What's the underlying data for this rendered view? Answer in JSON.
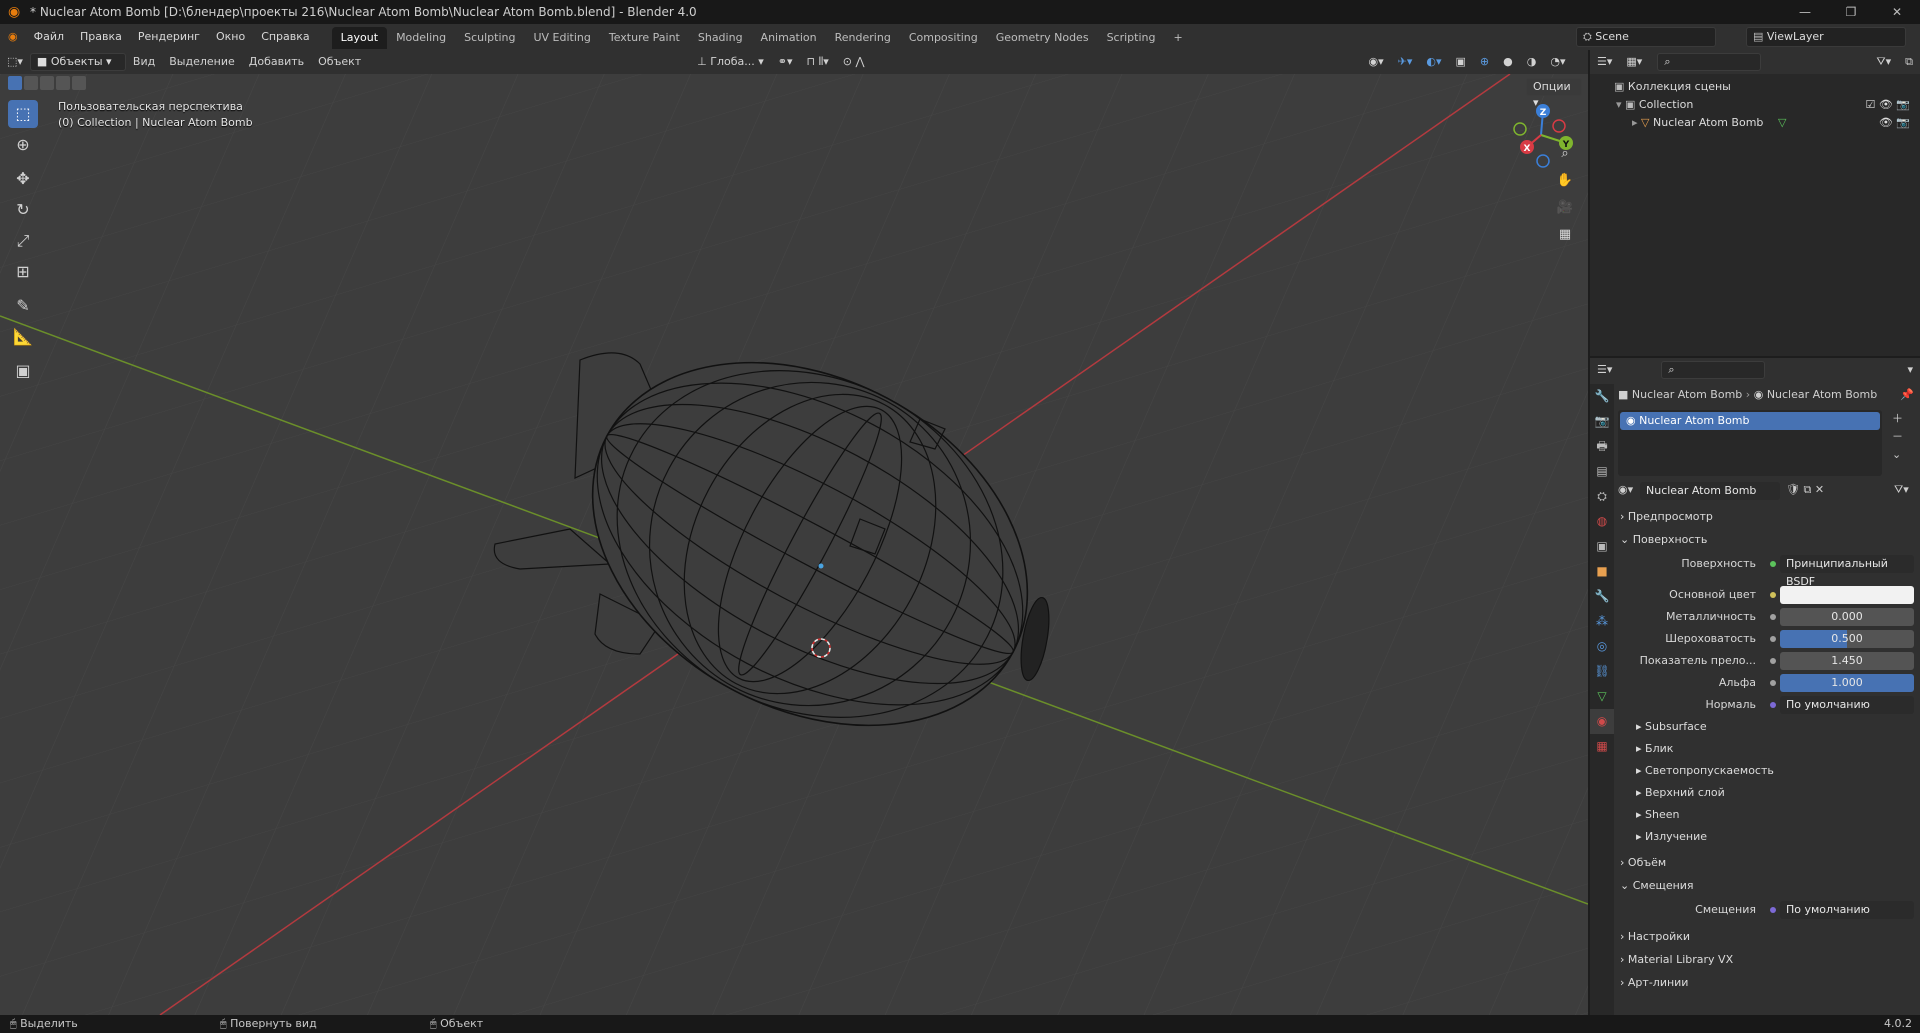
{
  "window": {
    "title": "* Nuclear Atom Bomb [D:\\блендер\\проекты 216\\Nuclear Atom Bomb\\Nuclear Atom Bomb.blend] - Blender 4.0"
  },
  "menu": [
    "Файл",
    "Правка",
    "Рендеринг",
    "Окно",
    "Справка"
  ],
  "workspaces": [
    "Layout",
    "Modeling",
    "Sculpting",
    "UV Editing",
    "Texture Paint",
    "Shading",
    "Animation",
    "Rendering",
    "Compositing",
    "Geometry Nodes",
    "Scripting",
    "+"
  ],
  "scene": {
    "name": "Scene",
    "view_layer": "ViewLayer"
  },
  "viewport_header": {
    "mode": "Объекты",
    "menus": [
      "Вид",
      "Выделение",
      "Добавить",
      "Объект"
    ],
    "orientation": "Глоба...",
    "options": "Опции"
  },
  "viewport": {
    "view_name": "Пользовательская перспектива",
    "collection_line": "(0) Collection | Nuclear Atom Bomb",
    "gizmo": {
      "x": "X",
      "y": "Y",
      "z": "Z"
    }
  },
  "outliner": {
    "root": "Коллекция сцены",
    "collection": "Collection",
    "object": "Nuclear Atom Bomb"
  },
  "properties": {
    "breadcrumb_object": "Nuclear Atom Bomb",
    "breadcrumb_material": "Nuclear Atom Bomb",
    "slot": "Nuclear Atom Bomb",
    "material_name": "Nuclear Atom Bomb",
    "sections": {
      "preview": "Предпросмотр",
      "surface": "Поверхность",
      "volume": "Объём",
      "displacement": "Смещения",
      "settings": "Настройки",
      "library": "Material Library VX",
      "lineart": "Арт-линии"
    },
    "surface": {
      "shader_label": "Поверхность",
      "shader_value": "Принципиальный BSDF",
      "base_color_label": "Основной цвет",
      "metallic_label": "Металличность",
      "metallic_value": "0.000",
      "roughness_label": "Шероховатость",
      "roughness_value": "0.500",
      "roughness_fill": 0.5,
      "ior_label": "Показатель прело...",
      "ior_value": "1.450",
      "alpha_label": "Альфа",
      "alpha_value": "1.000",
      "alpha_fill": 1.0,
      "normal_label": "Нормаль",
      "normal_value": "По умолчанию"
    },
    "subpanels": [
      "Subsurface",
      "Блик",
      "Светопропускаемость",
      "Верхний слой",
      "Sheen",
      "Излучение"
    ],
    "displacement": {
      "label": "Смещения",
      "value": "По умолчанию"
    }
  },
  "status": {
    "select": "Выделить",
    "rotate": "Повернуть вид",
    "object": "Объект",
    "version": "4.0.2"
  },
  "colors": {
    "accent": "#4772b3",
    "x_axis": "#c8393e",
    "y_axis": "#6a9a2a",
    "background": "#3d3d3d"
  }
}
